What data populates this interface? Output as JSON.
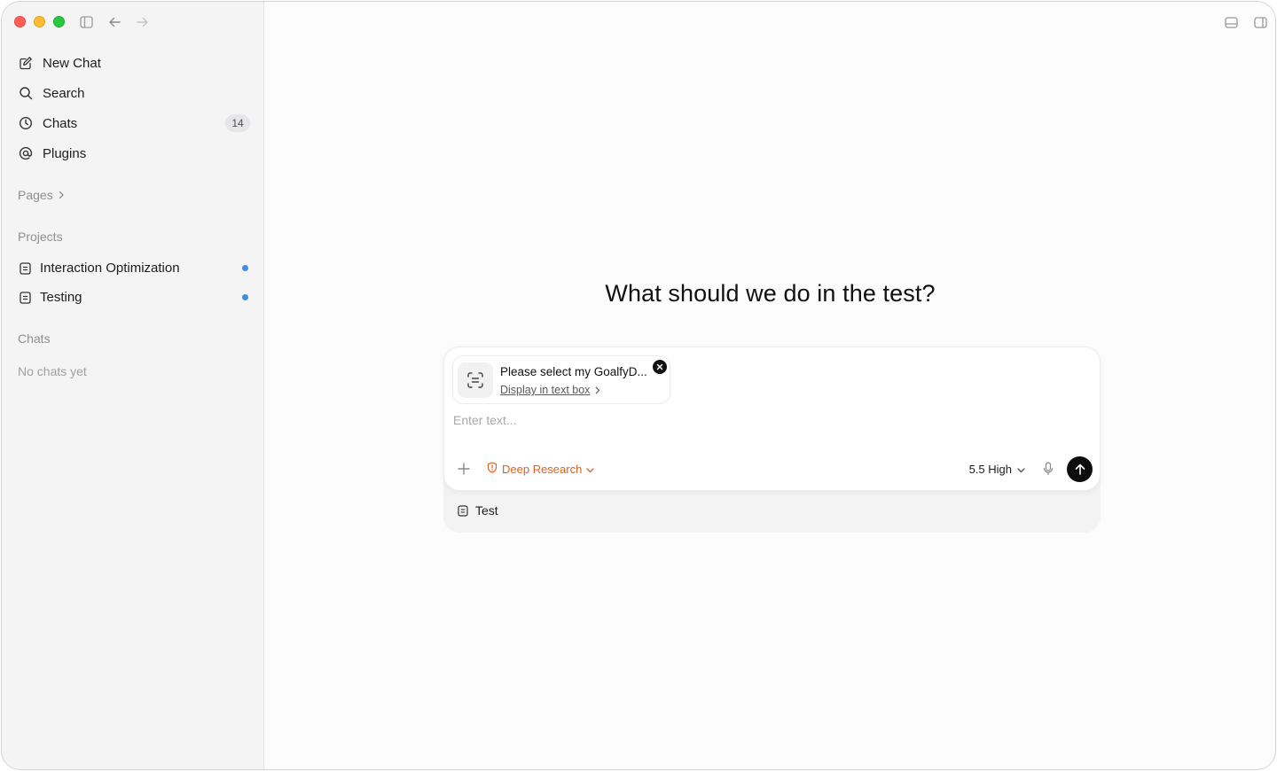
{
  "sidebar": {
    "nav": [
      {
        "label": "New Chat",
        "icon": "compose-icon"
      },
      {
        "label": "Search",
        "icon": "search-icon"
      },
      {
        "label": "Chats",
        "icon": "clock-icon",
        "badge": "14"
      },
      {
        "label": "Plugins",
        "icon": "at-sign-icon"
      }
    ],
    "pages_label": "Pages",
    "projects_label": "Projects",
    "projects": [
      {
        "label": "Interaction Optimization",
        "icon": "document-icon",
        "dot_color": "#3b8eea"
      },
      {
        "label": "Testing",
        "icon": "document-icon",
        "dot_color": "#3b8eea"
      }
    ],
    "chats_label": "Chats",
    "chats_empty": "No chats yet"
  },
  "main": {
    "headline": "What should we do in the test?",
    "composer": {
      "attachment": {
        "title": "Please select my GoalfyD...",
        "link": "Display in text box"
      },
      "placeholder": "Enter text...",
      "mode_label": "Deep Research",
      "mode_color": "#e0601f",
      "model_label": "5.5 High"
    },
    "context_item": "Test"
  },
  "colors": {
    "traffic_red": "#fe5f57",
    "traffic_yellow": "#febc2e",
    "traffic_green": "#28c840",
    "send_button": "#0d0d0d"
  }
}
